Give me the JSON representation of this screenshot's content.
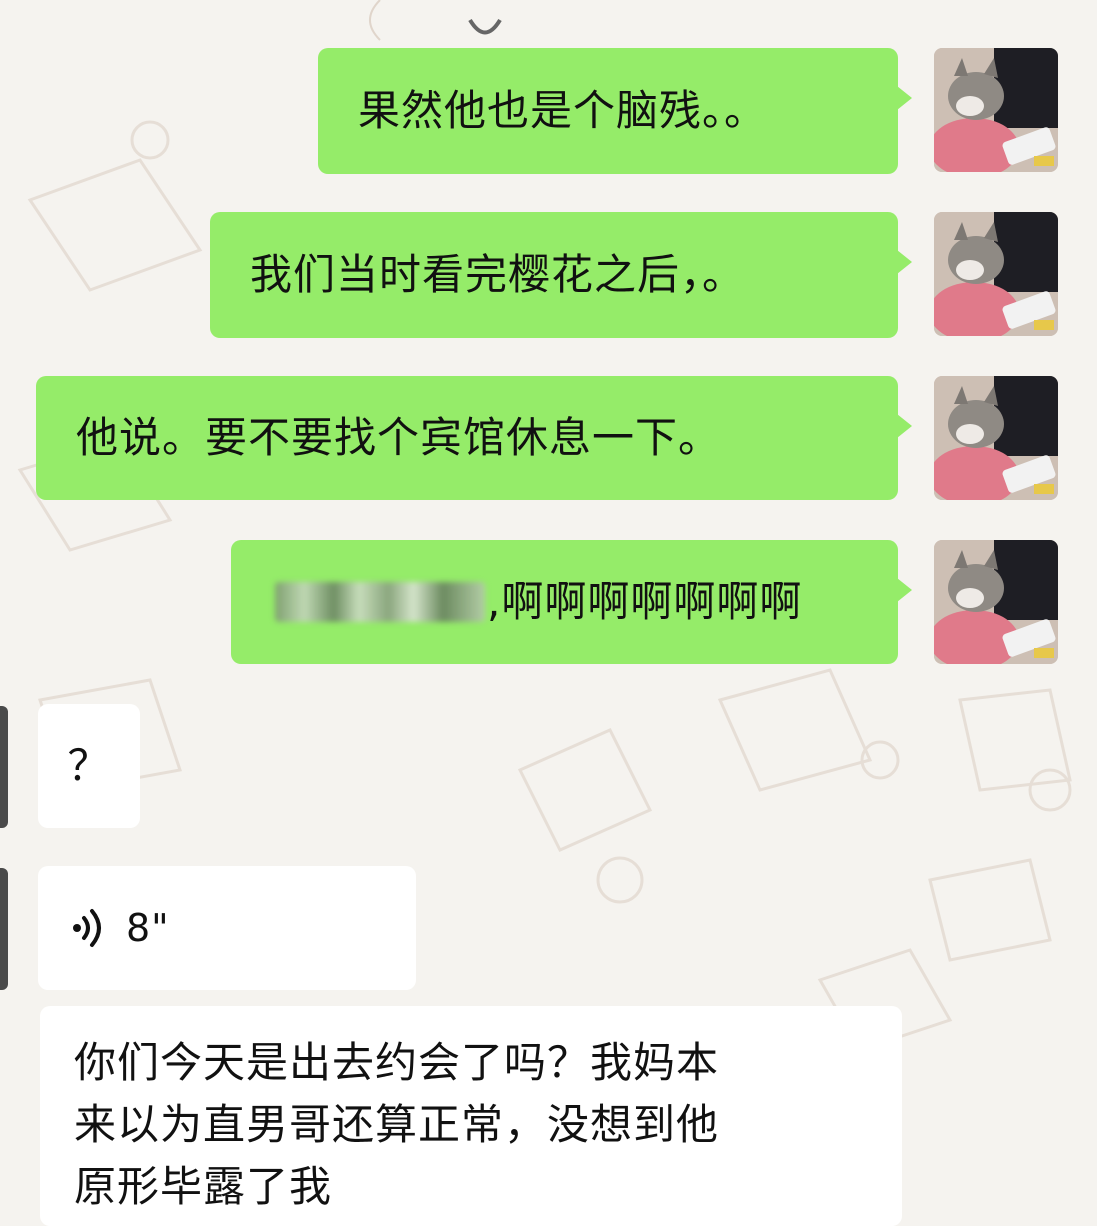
{
  "chat": {
    "messages": [
      {
        "direction": "out",
        "text": "果然他也是个脑残。。"
      },
      {
        "direction": "out",
        "text": "我们当时看完樱花之后，。"
      },
      {
        "direction": "out",
        "text": "他说。要不要找个宾馆休息一下。"
      },
      {
        "direction": "out",
        "text": ",啊啊啊啊啊啊啊",
        "redacted_prefix": true
      },
      {
        "direction": "in",
        "text": "？"
      },
      {
        "direction": "in",
        "type": "voice",
        "duration": "8\"",
        "icon": "voice-wave-icon"
      },
      {
        "direction": "in",
        "lines": [
          "你们今天是出去约会了吗？我妈本",
          "来以为直男哥还算正常，没想到他",
          "原形毕露了我"
        ]
      }
    ]
  },
  "theme": {
    "outgoing_bubble": "#95ec69",
    "incoming_bubble": "#ffffff",
    "wallpaper": "#f5f3ef"
  }
}
